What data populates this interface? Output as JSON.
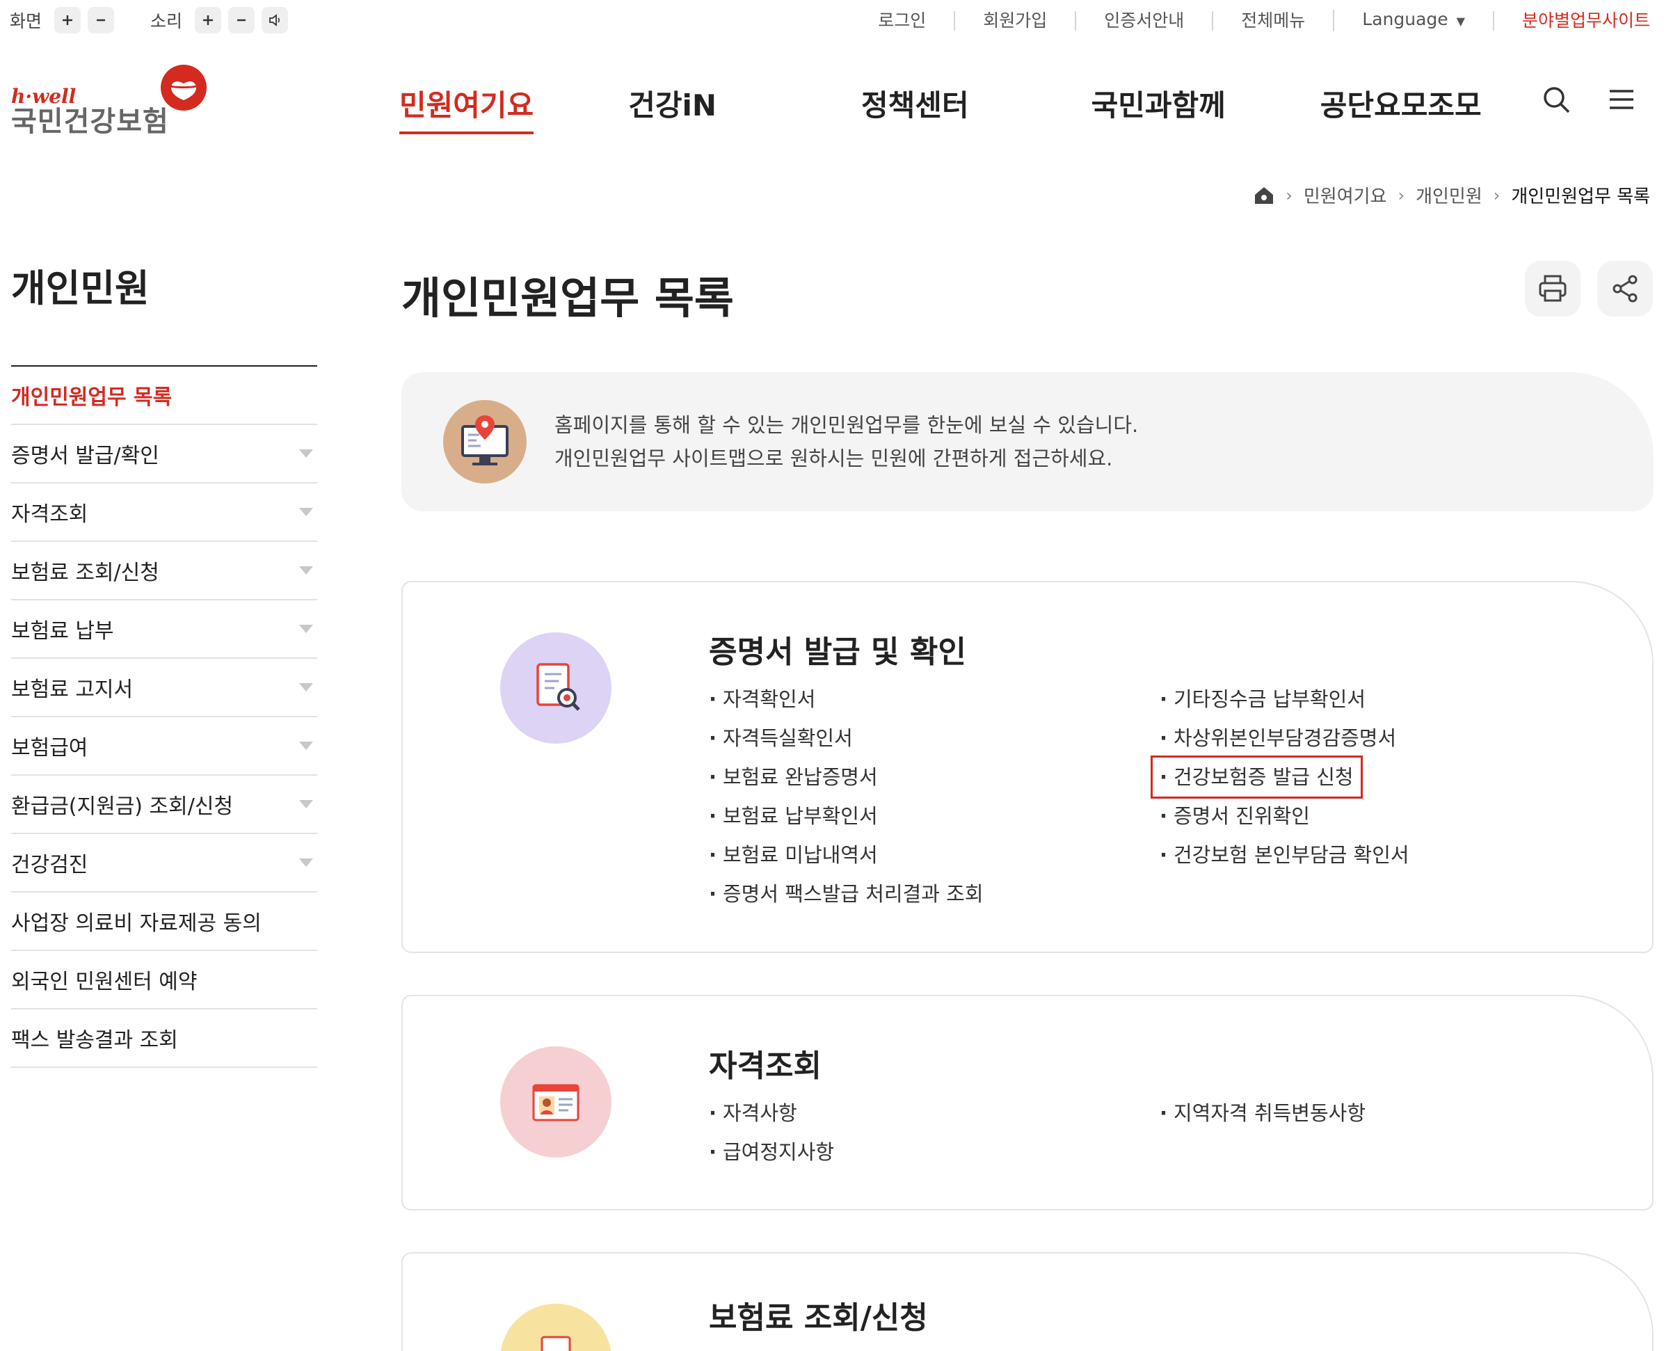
{
  "utility": {
    "screen_label": "화면",
    "sound_label": "소리",
    "links": [
      "로그인",
      "회원가입",
      "인증서안내",
      "전체메뉴"
    ],
    "language": "Language",
    "field_sites": "분야별업무사이트"
  },
  "logo": {
    "brand": "h·well",
    "name": "국민건강보험"
  },
  "gnb": [
    "민원여기요",
    "건강iN",
    "정책센터",
    "국민과함께",
    "공단요모조모"
  ],
  "breadcrumb": {
    "items": [
      "민원여기요",
      "개인민원"
    ],
    "current": "개인민원업무 목록"
  },
  "sidebar": {
    "title": "개인민원",
    "items": [
      {
        "label": "개인민원업무 목록"
      },
      {
        "label": "증명서 발급/확인"
      },
      {
        "label": "자격조회"
      },
      {
        "label": "보험료 조회/신청"
      },
      {
        "label": "보험료 납부"
      },
      {
        "label": "보험료 고지서"
      },
      {
        "label": "보험급여"
      },
      {
        "label": "환급금(지원금) 조회/신청"
      },
      {
        "label": "건강검진"
      },
      {
        "label": "사업장 의료비 자료제공 동의"
      },
      {
        "label": "외국인 민원센터 예약"
      },
      {
        "label": "팩스 발송결과 조회"
      }
    ]
  },
  "main": {
    "title": "개인민원업무 목록",
    "intro": [
      "홈페이지를 통해 할 수 있는 개인민원업무를 한눈에 보실 수 있습니다.",
      "개인민원업무 사이트맵으로 원하시는 민원에 간편하게 접근하세요."
    ],
    "sections": [
      {
        "title": "증명서 발급 및 확인",
        "left": [
          "자격확인서",
          "자격득실확인서",
          "보험료 완납증명서",
          "보험료 납부확인서",
          "보험료 미납내역서",
          "증명서 팩스발급 처리결과 조회"
        ],
        "right": [
          "기타징수금 납부확인서",
          "차상위본인부담경감증명서",
          "건강보험증 발급 신청",
          "증명서 진위확인",
          "건강보험 본인부담금 확인서"
        ]
      },
      {
        "title": "자격조회",
        "left": [
          "자격사항",
          "급여정지사항"
        ],
        "right": [
          "지역자격 취득변동사항"
        ]
      },
      {
        "title": "보험료 조회/신청"
      }
    ]
  },
  "colors": {
    "accent": "#d42a1f",
    "badge_purple": "#dcd3f5",
    "badge_pink": "#f6cfd2",
    "badge_yellow": "#f8e2a0"
  }
}
